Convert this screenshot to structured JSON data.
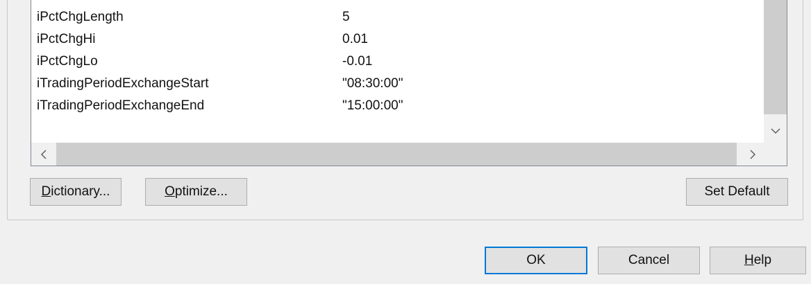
{
  "inputs": [
    {
      "name": "iPctChgLength",
      "value": "5"
    },
    {
      "name": "iPctChgHi",
      "value": "0.01"
    },
    {
      "name": "iPctChgLo",
      "value": "-0.01"
    },
    {
      "name": "iTradingPeriodExchangeStart",
      "value": "\"08:30:00\""
    },
    {
      "name": "iTradingPeriodExchangeEnd",
      "value": "\"15:00:00\""
    }
  ],
  "scrollbars": {
    "vertical_down_icon": "chevron-down-icon",
    "horizontal_left_icon": "chevron-left-icon",
    "horizontal_right_icon": "chevron-right-icon",
    "down_glyph": "﹀",
    "left_glyph": "<",
    "right_glyph": ">"
  },
  "buttons": {
    "dictionary": {
      "mnemonic": "D",
      "rest": "ictionary..."
    },
    "optimize": {
      "mnemonic": "O",
      "rest": "ptimize..."
    },
    "set_default": "Set Default",
    "ok": "OK",
    "cancel": "Cancel",
    "help": {
      "mnemonic": "H",
      "rest": "elp"
    }
  },
  "colors": {
    "window_bg": "#f0f0f0",
    "default_button_border": "#0078d7",
    "button_bg": "#e1e1e1"
  }
}
